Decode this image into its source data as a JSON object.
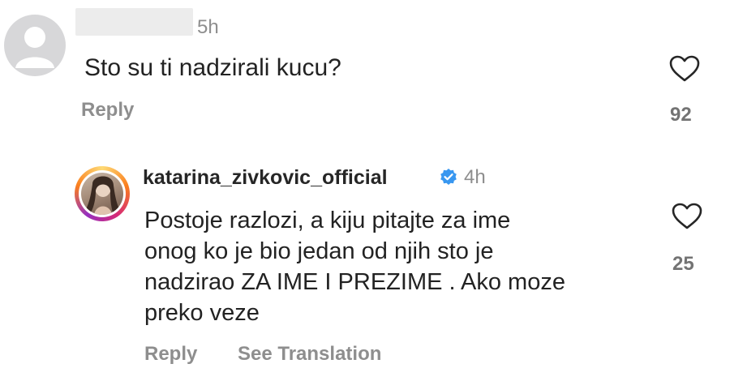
{
  "comment": {
    "time": "5h",
    "text": "Sto su ti nadzirali kucu?",
    "reply_label": "Reply",
    "like_count": "92",
    "like_icon": "heart-outline-icon"
  },
  "reply": {
    "username": "katarina_zivkovic_official",
    "verified_icon": "verified-badge-icon",
    "time": "4h",
    "text_lines": [
      "Postoje razlozi, a kiju pitajte za ime",
      "onog ko je bio jedan od njih sto je",
      "nadzirao ZA IME I PREZIME . Ako moze",
      "preko veze"
    ],
    "reply_label": "Reply",
    "translate_label": "See Translation",
    "like_count": "25",
    "like_icon": "heart-outline-icon"
  },
  "colors": {
    "verified_blue": "#3897f0",
    "secondary_text": "#8e8e8e"
  }
}
